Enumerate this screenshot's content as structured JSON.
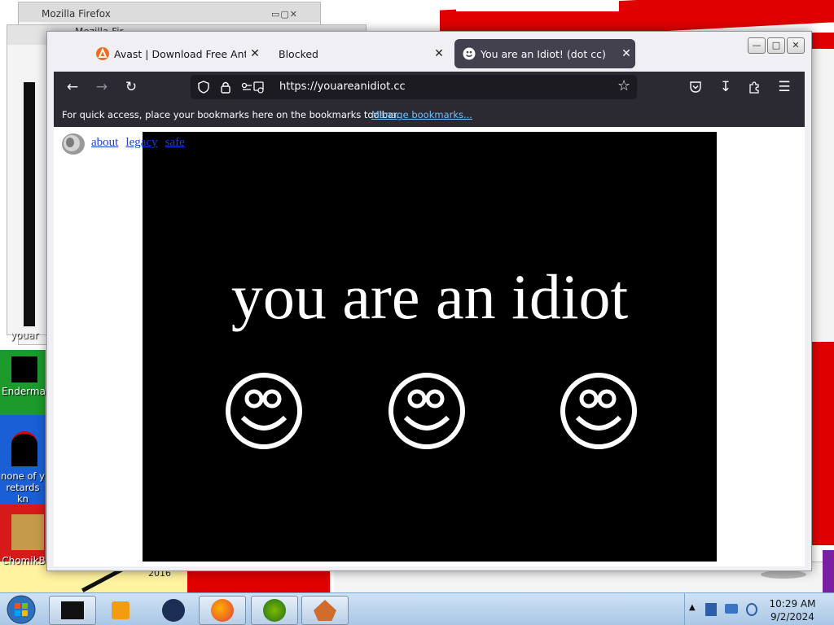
{
  "desktop": {
    "ghost_window_title": "Mozilla Firefox",
    "ghost_window_title_2": "Mozilla Fir",
    "icons": [
      {
        "label": "youar"
      },
      {
        "label": "Enderma"
      },
      {
        "label": "none of y retards kn"
      },
      {
        "label": "ChomikB"
      }
    ],
    "year_label": "2016",
    "colors": {
      "red": "#e00000",
      "blue": "#1a3fd6",
      "green": "#1c9a2c",
      "yellow": "#fff3a0",
      "purple": "#7b1fa2"
    }
  },
  "browser": {
    "tabs": [
      {
        "title": "Avast | Download Free Antivirus",
        "icon": "avast-icon",
        "active": false
      },
      {
        "title": "Blocked",
        "icon": "none",
        "active": false
      },
      {
        "title": "You are an Idiot! (dot cc)",
        "icon": "smiley-icon",
        "active": true
      }
    ],
    "window_controls": {
      "minimize": "—",
      "maximize": "□",
      "close": "✕"
    },
    "nav": {
      "back_icon": "back-arrow-icon",
      "forward_icon": "forward-arrow-icon",
      "reload_icon": "reload-icon"
    },
    "url": "https://youareanidiot.cc",
    "bookmarks_bar": {
      "text": "For quick access, place your bookmarks here on the bookmarks toolbar.",
      "link": "Manage bookmarks..."
    }
  },
  "page": {
    "links": [
      "about",
      "legacy",
      "safe"
    ],
    "headline": "you are an idiot",
    "smiley_count": 3
  },
  "taskbar": {
    "time": "10:29 AM",
    "date": "9/2/2024"
  }
}
